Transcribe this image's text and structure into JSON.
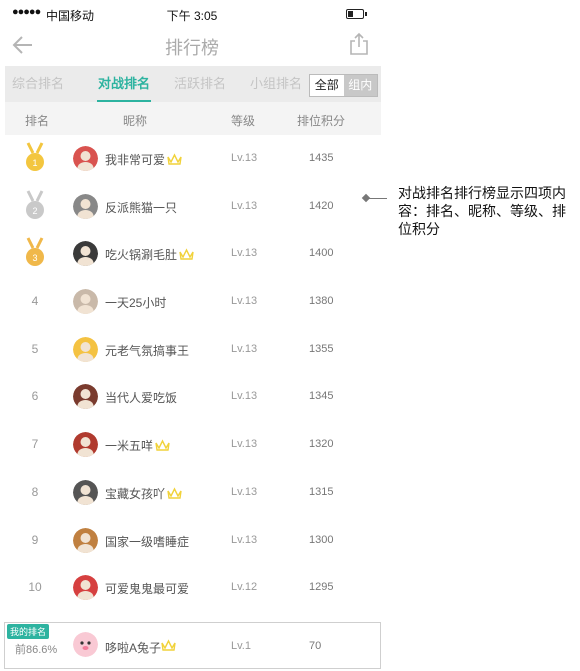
{
  "status_bar": {
    "signal": "●●●●●",
    "carrier": "中国移动",
    "time": "下午 3:05"
  },
  "nav": {
    "title": "排行榜",
    "back_icon": "arrow-left-icon",
    "share_icon": "share-icon"
  },
  "tabs": [
    {
      "label": "综合排名",
      "active": false
    },
    {
      "label": "对战排名",
      "active": true
    },
    {
      "label": "活跃排名",
      "active": false
    },
    {
      "label": "小组排名",
      "active": false
    }
  ],
  "scope_toggle": {
    "all": "全部",
    "group": "组内",
    "selected": "全部"
  },
  "columns": {
    "rank": "排名",
    "nickname": "昵称",
    "level": "等级",
    "score": "排位积分"
  },
  "rows": [
    {
      "rank": "1",
      "medal": "gold",
      "name": "我非常可爱",
      "crown": true,
      "level": "Lv.13",
      "score": "1435"
    },
    {
      "rank": "2",
      "medal": "silver",
      "name": "反派熊猫一只",
      "crown": false,
      "level": "Lv.13",
      "score": "1420"
    },
    {
      "rank": "3",
      "medal": "bronze",
      "name": "吃火锅涮毛肚",
      "crown": true,
      "level": "Lv.13",
      "score": "1400"
    },
    {
      "rank": "4",
      "medal": "",
      "name": "一天25小时",
      "crown": false,
      "level": "Lv.13",
      "score": "1380"
    },
    {
      "rank": "5",
      "medal": "",
      "name": "元老气氛搞事王",
      "crown": false,
      "level": "Lv.13",
      "score": "1355"
    },
    {
      "rank": "6",
      "medal": "",
      "name": "当代人爱吃饭",
      "crown": false,
      "level": "Lv.13",
      "score": "1345"
    },
    {
      "rank": "7",
      "medal": "",
      "name": "一米五咩",
      "crown": true,
      "level": "Lv.13",
      "score": "1320"
    },
    {
      "rank": "8",
      "medal": "",
      "name": "宝藏女孩吖",
      "crown": true,
      "level": "Lv.13",
      "score": "1315"
    },
    {
      "rank": "9",
      "medal": "",
      "name": "国家一级嗜睡症",
      "crown": false,
      "level": "Lv.13",
      "score": "1300"
    },
    {
      "rank": "10",
      "medal": "",
      "name": "可爱鬼鬼最可爱",
      "crown": false,
      "level": "Lv.12",
      "score": "1295"
    }
  ],
  "my_rank": {
    "tag": "我的排名",
    "percent": "前86.6%",
    "name": "哆啦A兔子",
    "crown": true,
    "level": "Lv.1",
    "score": "70"
  },
  "annotation": {
    "text": "对战排名排行榜显示四项内容：排名、昵称、等级、排位积分"
  },
  "colors": {
    "accent": "#2db3a0",
    "gold": "#f3c63f",
    "silver": "#c9c9c9",
    "bronze": "#f0b84a",
    "crown": "#f1d23a"
  }
}
